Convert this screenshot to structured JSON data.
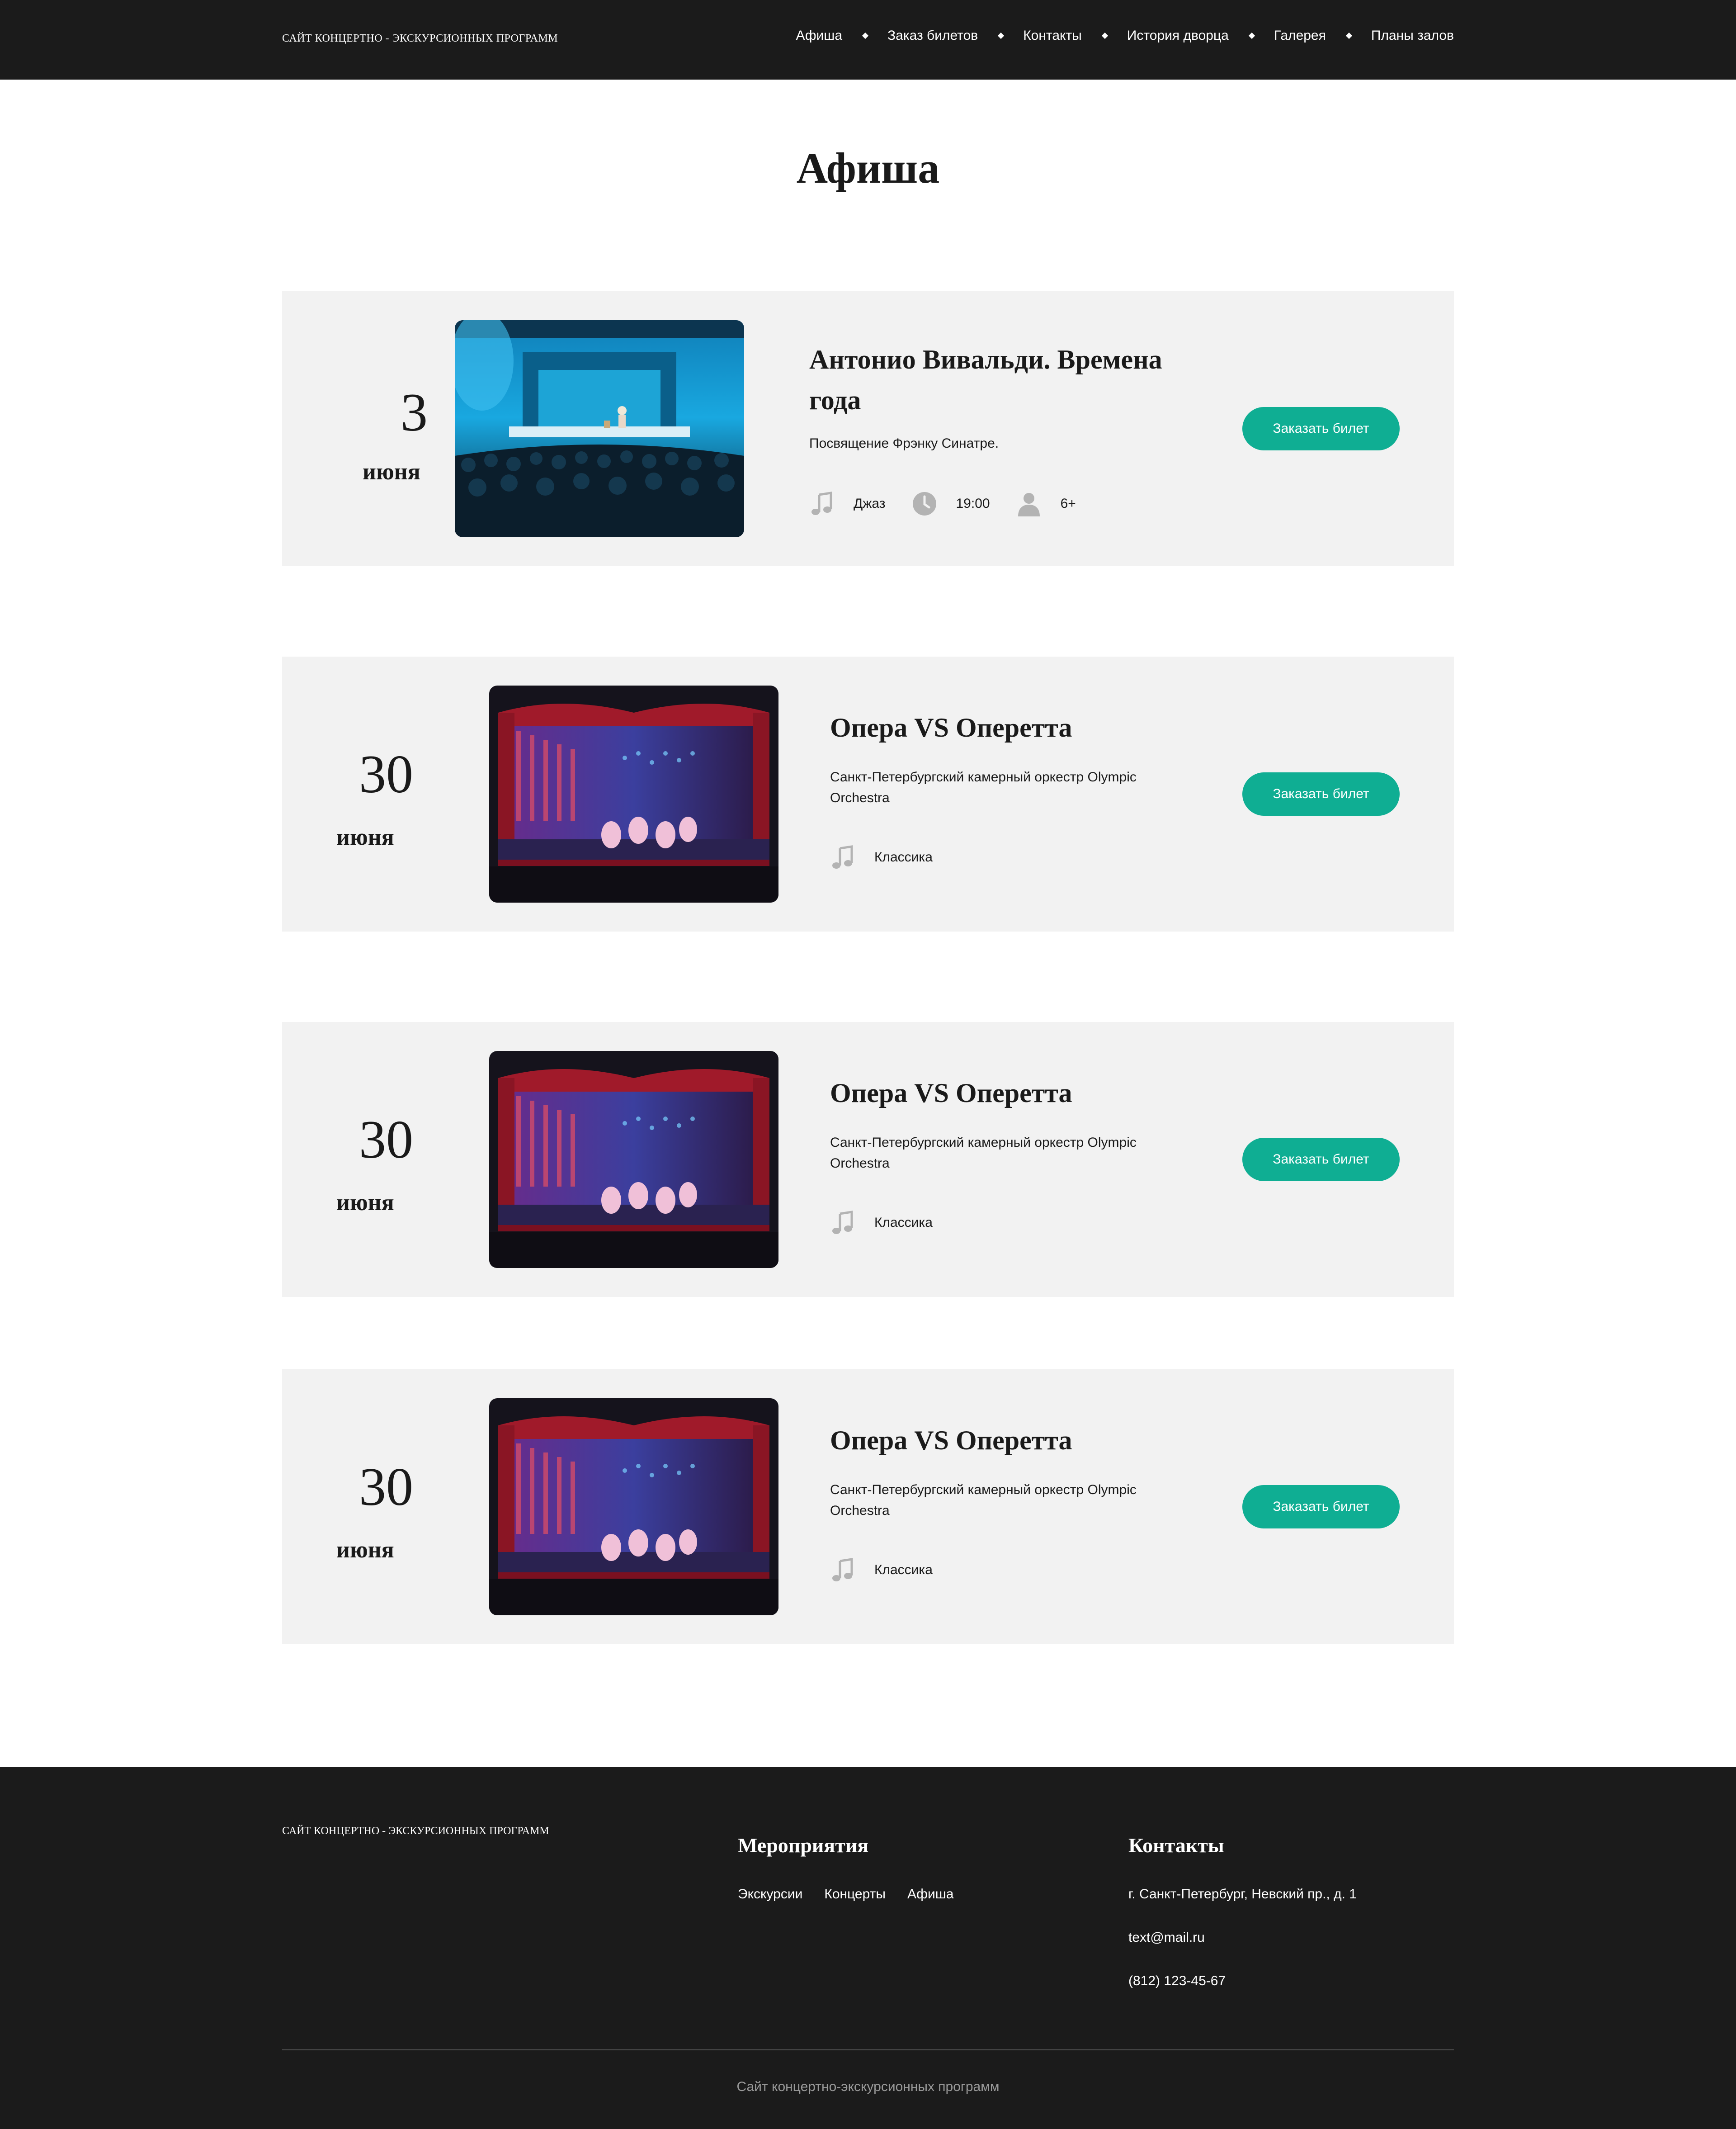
{
  "header": {
    "logo": "Сайт концертно - экскурсионных программ",
    "nav": [
      "Афиша",
      "Заказ билетов",
      "Контакты",
      "История дворца",
      "Галерея",
      "Планы залов"
    ]
  },
  "page_title": "Афиша",
  "events": [
    {
      "day": "3",
      "month": "июня",
      "title": "Антонио Вивальди. Времена года",
      "description": "Посвящение Фрэнку Синатре.",
      "genre": "Джаз",
      "time": "19:00",
      "age": "6+",
      "button": "Заказать билет"
    },
    {
      "day": "30",
      "month": "июня",
      "title": "Опера VS Оперетта",
      "description": "Санкт-Петербургский камерный оркестр Olympic Orchestra",
      "genre": "Классика",
      "button": "Заказать билет"
    },
    {
      "day": "30",
      "month": "июня",
      "title": "Опера VS Оперетта",
      "description": "Санкт-Петербургский камерный оркестр Olympic Orchestra",
      "genre": "Классика",
      "button": "Заказать билет"
    },
    {
      "day": "30",
      "month": "июня",
      "title": "Опера VS Оперетта",
      "description": "Санкт-Петербургский камерный оркестр Olympic Orchestra",
      "genre": "Классика",
      "button": "Заказать билет"
    }
  ],
  "footer": {
    "logo": "Сайт концертно - экскурсионных программ",
    "events_heading": "Мероприятия",
    "events_links": [
      "Экскурсии",
      "Концерты",
      "Афиша"
    ],
    "contacts_heading": "Контакты",
    "address": "г. Санкт-Петербург, Невский пр., д. 1",
    "email": "text@mail.ru",
    "phone": "(812) 123-45-67",
    "copyright": "Сайт концертно-экскурсионных программ"
  },
  "colors": {
    "header_bg": "#1b1b1b",
    "card_bg": "#f2f2f2",
    "button": "#0fae93",
    "icon": "#b3b3b3"
  },
  "icons": {
    "genre": "music-note-icon",
    "time": "clock-icon",
    "age": "person-icon",
    "nav_separator": "diamond-icon"
  }
}
